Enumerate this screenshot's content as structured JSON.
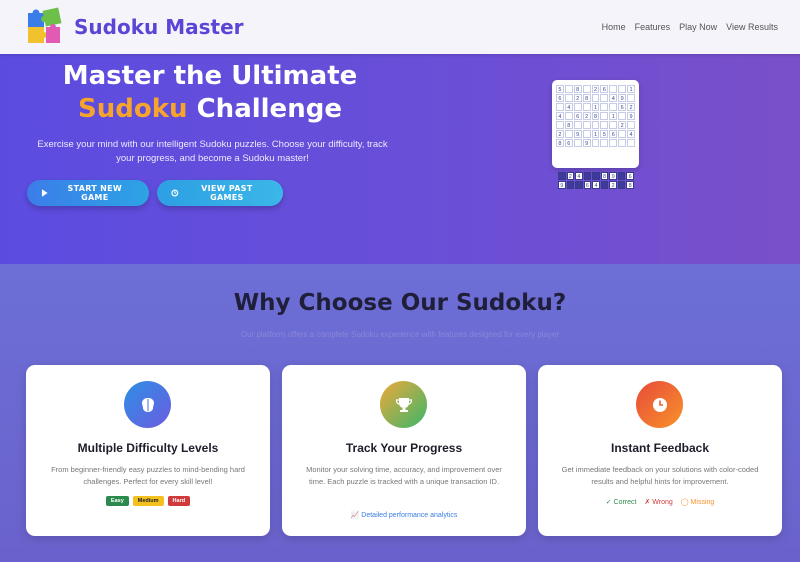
{
  "header": {
    "brand": "Sudoku Master",
    "nav": [
      "Home",
      "Features",
      "Play Now",
      "View Results"
    ]
  },
  "hero": {
    "title_line1": "Master the Ultimate",
    "title_accent": "Sudoku",
    "title_line2_rest": " Challenge",
    "subtitle": "Exercise your mind with our intelligent Sudoku puzzles. Choose your difficulty, track your progress, and become a Sudoku master!",
    "start_button": "START NEW GAME",
    "past_button": "VIEW PAST GAMES",
    "mini_board": [
      [
        "5",
        "",
        "8",
        "",
        "2",
        "6",
        "",
        "",
        "1"
      ],
      [
        "6",
        "",
        "2",
        "8",
        "",
        "",
        "4",
        "9",
        ""
      ],
      [
        "",
        "4",
        "",
        "",
        "1",
        "",
        "",
        "6",
        "2"
      ],
      [
        "4",
        "",
        "6",
        "2",
        "8",
        "",
        "1",
        "",
        "9"
      ],
      [
        "",
        "8",
        "",
        "",
        "",
        "",
        "",
        "2",
        ""
      ],
      [
        "2",
        "",
        "9",
        "",
        "1",
        "5",
        "6",
        "",
        "4"
      ],
      [
        "8",
        "6",
        "",
        "9",
        "",
        "",
        "",
        "",
        ""
      ]
    ],
    "mini_overflow": [
      [
        "",
        "2",
        "4",
        "",
        "",
        "8",
        "9",
        "",
        "6"
      ],
      [
        "9",
        "",
        "",
        "6",
        "4",
        "",
        "2",
        "",
        "8"
      ]
    ]
  },
  "why": {
    "title": "Why Choose Our Sudoku?",
    "subtitle": "Our platform offers a complete Sudoku experience with features designed for every player",
    "cards": [
      {
        "title": "Multiple Difficulty Levels",
        "text": "From beginner-friendly easy puzzles to mind-bending hard challenges. Perfect for every skill level!",
        "icon": "brain-icon"
      },
      {
        "title": "Track Your Progress",
        "text": "Monitor your solving time, accuracy, and improvement over time. Each puzzle is tracked with a unique transaction ID.",
        "icon": "trophy-icon",
        "link": "Detailed performance analytics"
      },
      {
        "title": "Instant Feedback",
        "text": "Get immediate feedback on your solutions with color-coded results and helpful hints for improvement.",
        "icon": "clock-icon"
      }
    ],
    "badges": [
      "Easy",
      "Medium",
      "Hard"
    ],
    "feedback": {
      "correct": "✓ Correct",
      "wrong": "✗ Wrong",
      "missing": "◯ Missing"
    }
  },
  "colors": {
    "accent": "#f7a42c",
    "brand": "#5a45d6",
    "easy": "#2d8a4e",
    "medium": "#f4c01e",
    "hard": "#d03a3a"
  }
}
